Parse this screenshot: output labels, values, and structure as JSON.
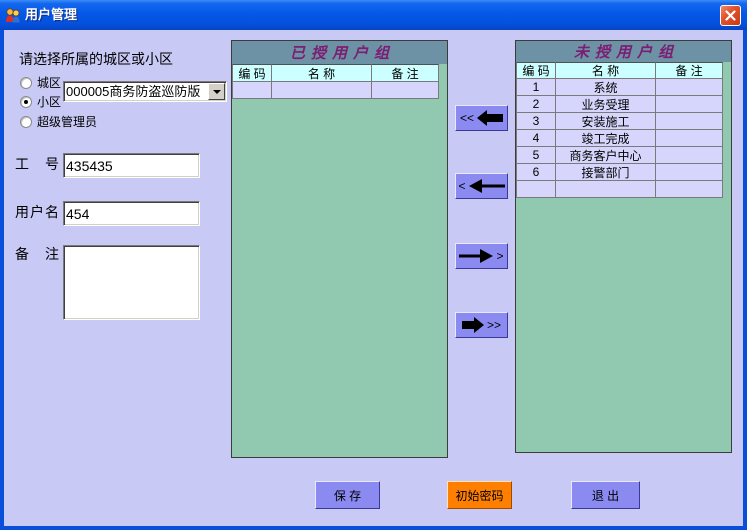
{
  "window": {
    "title": "用户管理",
    "icon": "users-icon",
    "close_icon": "close-icon"
  },
  "scope": {
    "prompt": "请选择所属的城区或小区",
    "options": [
      {
        "label": "城区",
        "checked": false
      },
      {
        "label": "小区",
        "checked": true
      },
      {
        "label": "超级管理员",
        "checked": false
      }
    ],
    "area_select": {
      "value": "000005商务防盗巡防版",
      "icon": "dropdown-arrow-icon"
    }
  },
  "form": {
    "employee_no": {
      "label": "工　号",
      "value": "435435"
    },
    "username": {
      "label": "用户名",
      "value": "454"
    },
    "remark": {
      "label": "备　注",
      "value": ""
    }
  },
  "granted_groups": {
    "title": "已授用户组",
    "columns": {
      "code": "编 码",
      "name": "名 称",
      "note": "备 注"
    },
    "rows": [
      {
        "code": "",
        "name": "",
        "note": ""
      }
    ]
  },
  "available_groups": {
    "title": "未授用户组",
    "columns": {
      "code": "编 码",
      "name": "名 称",
      "note": "备 注"
    },
    "rows": [
      {
        "code": "1",
        "name": "系统",
        "note": ""
      },
      {
        "code": "2",
        "name": "业务受理",
        "note": ""
      },
      {
        "code": "3",
        "name": "安装施工",
        "note": ""
      },
      {
        "code": "4",
        "name": "竣工完成",
        "note": ""
      },
      {
        "code": "5",
        "name": "商务客户中心",
        "note": ""
      },
      {
        "code": "6",
        "name": "接警部门",
        "note": ""
      },
      {
        "code": "",
        "name": "",
        "note": ""
      }
    ]
  },
  "transfer_buttons": {
    "add_all": {
      "text": "<<",
      "icon": "left-block-arrow-icon"
    },
    "add_one": {
      "text": "<",
      "icon": "left-arrow-icon"
    },
    "remove_one": {
      "text": ">",
      "icon": "right-arrow-icon"
    },
    "remove_all": {
      "text": ">>",
      "icon": "right-block-arrow-icon"
    }
  },
  "actions": {
    "save": "保 存",
    "reset_password": "初始密码",
    "exit": "退 出"
  },
  "colors": {
    "window_frame": "#0A4FD9",
    "client_background": "#C9C9F6",
    "grid_title_band": "#6E92A5",
    "grid_title_text": "#7B1D72",
    "grid_body": "#91C8B0",
    "grid_header_cell": "#CCFFFF",
    "grid_row": "#D6D6FC",
    "button": "#8A8AF0",
    "highlight_button": "#FF8000"
  }
}
